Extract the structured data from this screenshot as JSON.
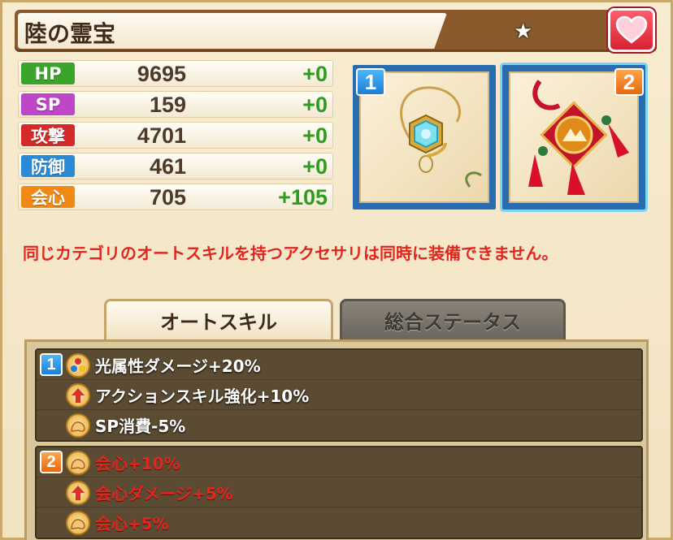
{
  "header": {
    "title": "陸の霊宝",
    "rarity_icon": "star-icon",
    "favorite_icon": "heart-icon"
  },
  "stats": [
    {
      "label": "HP",
      "value": "9695",
      "bonus": "+0",
      "color": "#3aa52a"
    },
    {
      "label": "SP",
      "value": "159",
      "bonus": "+0",
      "color": "#c046c9"
    },
    {
      "label": "攻撃",
      "value": "4701",
      "bonus": "+0",
      "color": "#d62a2a"
    },
    {
      "label": "防御",
      "value": "461",
      "bonus": "+0",
      "color": "#2b8ad6"
    },
    {
      "label": "会心",
      "value": "705",
      "bonus": "+105",
      "color": "#f08a14"
    }
  ],
  "accessories": [
    {
      "slot": "1",
      "icon": "hexagon-pendant-icon"
    },
    {
      "slot": "2",
      "icon": "red-tassel-charm-icon"
    }
  ],
  "warning": "同じカテゴリのオートスキルを持つアクセサリは同時に装備できません。",
  "tabs": [
    {
      "label": "オートスキル",
      "active": true
    },
    {
      "label": "総合ステータス",
      "active": false
    }
  ],
  "skill_groups": [
    {
      "slot": "1",
      "skills": [
        {
          "text": "光属性ダメージ+20%",
          "icon": "element-orbs-icon",
          "active": true
        },
        {
          "text": "アクションスキル強化+10%",
          "icon": "arrow-up-icon",
          "active": true
        },
        {
          "text": "SP消費-5%",
          "icon": "muscle-arm-icon",
          "active": true
        }
      ]
    },
    {
      "slot": "2",
      "skills": [
        {
          "text": "会心+10%",
          "icon": "muscle-arm-icon",
          "active": false
        },
        {
          "text": "会心ダメージ+5%",
          "icon": "arrow-up-icon",
          "active": false
        },
        {
          "text": "会心+5%",
          "icon": "muscle-arm-icon",
          "active": false
        }
      ]
    }
  ]
}
